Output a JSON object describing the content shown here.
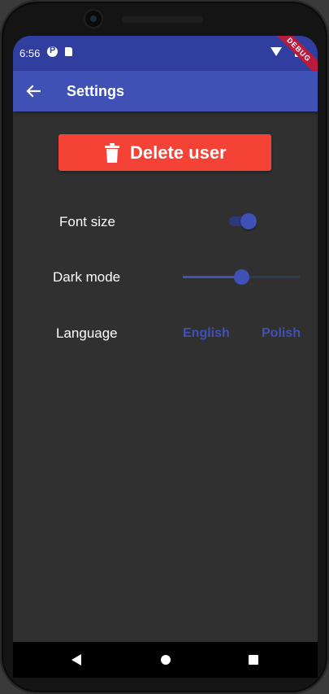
{
  "status_bar": {
    "time": "6:56",
    "debug_banner": "DEBUG"
  },
  "app_bar": {
    "title": "Settings",
    "back_icon": "arrow-back-icon"
  },
  "delete_button": {
    "label": "Delete user",
    "icon": "trash-icon",
    "color": "#f44336"
  },
  "settings": {
    "font_size": {
      "label": "Font size",
      "toggle_on": true
    },
    "dark_mode": {
      "label": "Dark mode",
      "slider_value": 0.5
    },
    "language": {
      "label": "Language",
      "options": [
        "English",
        "Polish"
      ]
    }
  },
  "theme": {
    "primary": "#3f51b5",
    "primary_dark": "#303f9f",
    "background": "#303030"
  },
  "nav_bar": {
    "icons": [
      "back-icon",
      "home-icon",
      "recent-apps-icon"
    ]
  }
}
